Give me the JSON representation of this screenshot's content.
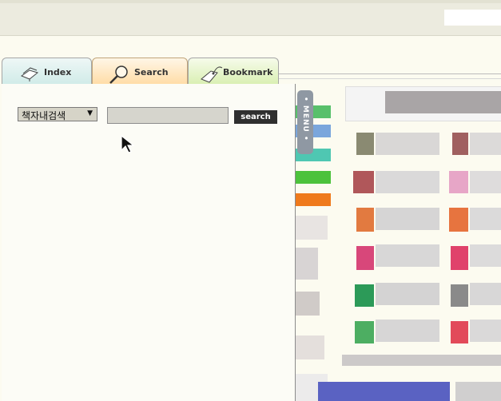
{
  "tabs": [
    {
      "label": "Index",
      "icon": "book-icon"
    },
    {
      "label": "Search",
      "icon": "magnifier-icon"
    },
    {
      "label": "Bookmark",
      "icon": "tag-icon"
    }
  ],
  "search": {
    "scope_selected": "책자내검색",
    "query": "",
    "button_label": "search"
  },
  "side_handle": {
    "label": "• MENU •"
  },
  "colors": {
    "index_tab": "#d0ebe8",
    "search_tab": "#ffdca6",
    "bookmark_tab": "#d9efb2",
    "panel_bg": "#fcfcf6",
    "button_bg": "#2f2f2f"
  }
}
